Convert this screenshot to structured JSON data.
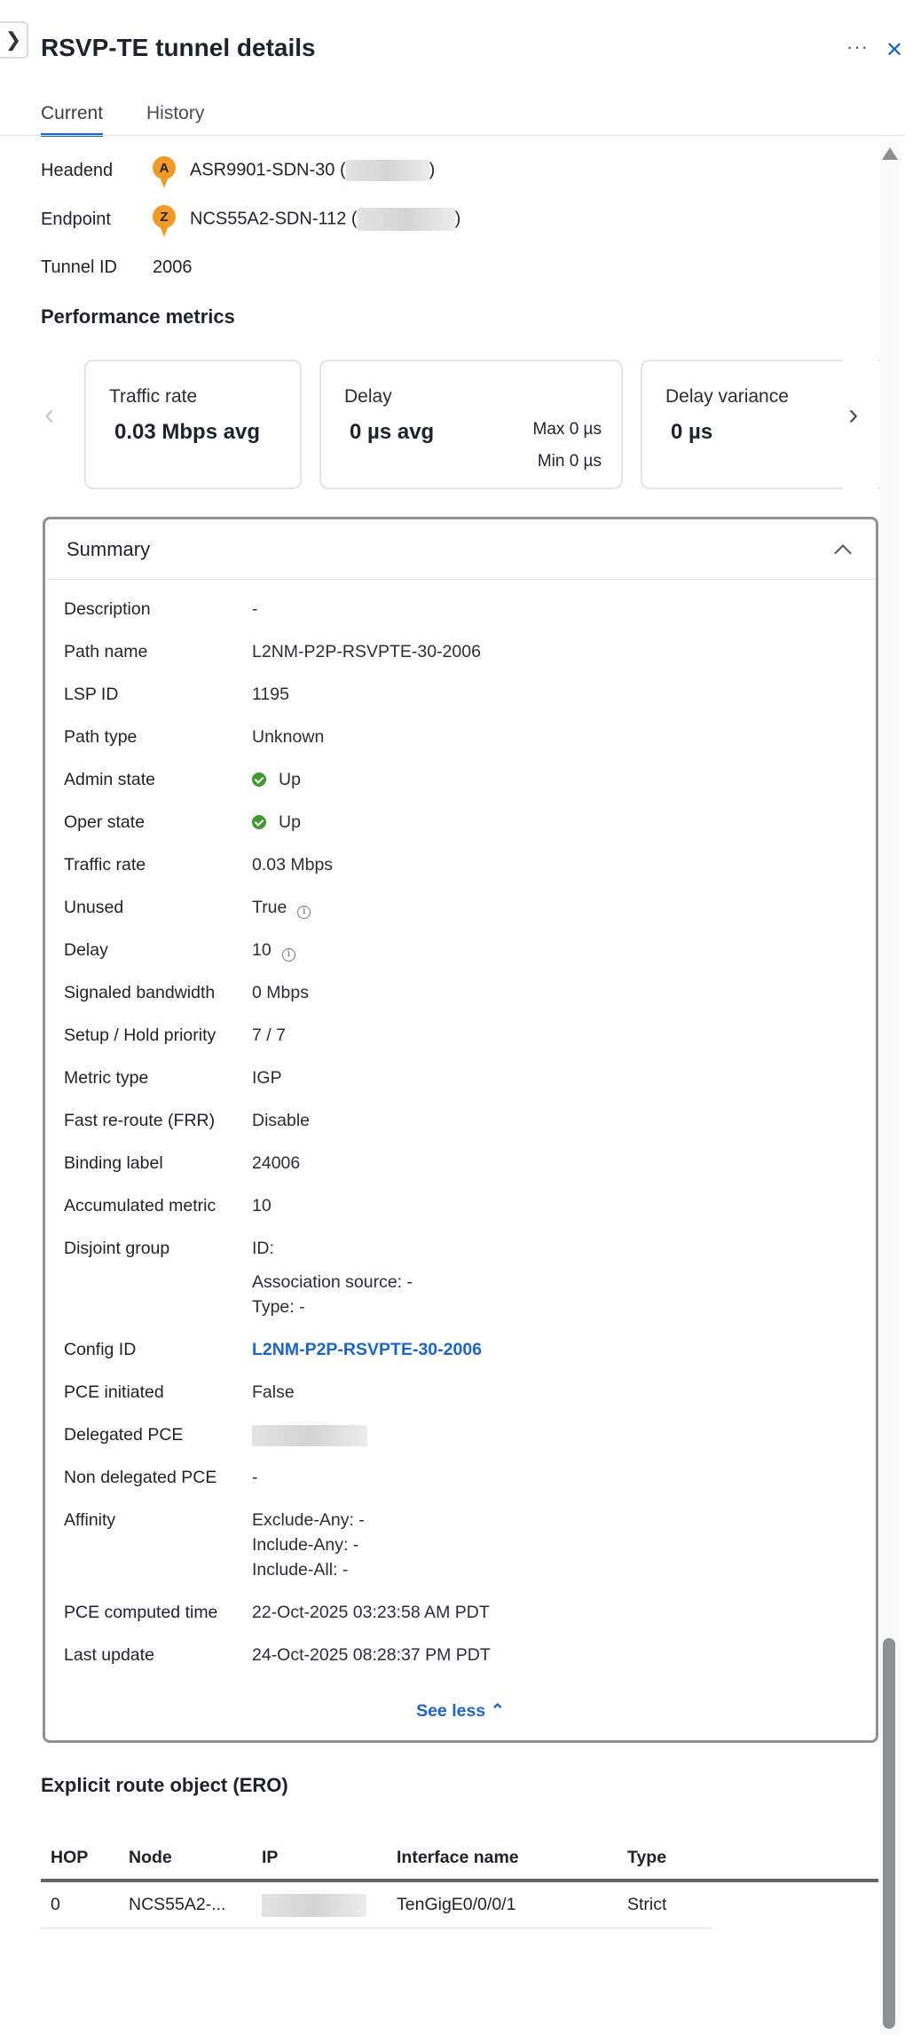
{
  "header": {
    "title": "RSVP-TE tunnel details",
    "more_label": "···",
    "close_label": "✕",
    "collapse_label": "❯"
  },
  "tabs": [
    {
      "label": "Current",
      "active": true
    },
    {
      "label": "History",
      "active": false
    }
  ],
  "info": {
    "headend": {
      "label": "Headend",
      "marker": "A",
      "value": "ASR9901-SDN-30 (",
      "suffix": ")"
    },
    "endpoint": {
      "label": "Endpoint",
      "marker": "Z",
      "value": "NCS55A2-SDN-112 (",
      "suffix": ")"
    },
    "tunnel_id": {
      "label": "Tunnel ID",
      "value": "2006"
    }
  },
  "performance": {
    "title": "Performance metrics",
    "cards": [
      {
        "label": "Traffic rate",
        "value": "0.03 Mbps avg"
      },
      {
        "label": "Delay",
        "value": "0 µs avg",
        "max": "Max 0 µs",
        "min": "Min 0 µs"
      },
      {
        "label": "Delay variance",
        "value": "0 µs"
      }
    ]
  },
  "summary": {
    "title": "Summary",
    "see_less": "See less ⌃",
    "rows": [
      {
        "label": "Description",
        "value": "-"
      },
      {
        "label": "Path name",
        "value": "L2NM-P2P-RSVPTE-30-2006"
      },
      {
        "label": "LSP ID",
        "value": "1195"
      },
      {
        "label": "Path type",
        "value": "Unknown"
      },
      {
        "label": "Admin state",
        "value": "Up"
      },
      {
        "label": "Oper state",
        "value": "Up"
      },
      {
        "label": "Traffic rate",
        "value": "0.03 Mbps"
      },
      {
        "label": "Unused",
        "value": "True"
      },
      {
        "label": "Delay",
        "value": "10"
      },
      {
        "label": "Signaled bandwidth",
        "value": "0 Mbps"
      },
      {
        "label": "Setup / Hold priority",
        "value": "7 / 7"
      },
      {
        "label": "Metric type",
        "value": "IGP"
      },
      {
        "label": "Fast re-route (FRR)",
        "value": "Disable"
      },
      {
        "label": "Binding label",
        "value": "24006"
      },
      {
        "label": "Accumulated metric",
        "value": "10"
      },
      {
        "label": "Disjoint group",
        "value": "ID:",
        "value2": "Association source: -",
        "value3": "Type: -"
      },
      {
        "label": "Config ID",
        "value": "L2NM-P2P-RSVPTE-30-2006"
      },
      {
        "label": "PCE initiated",
        "value": "False"
      },
      {
        "label": "Delegated PCE",
        "value": ""
      },
      {
        "label": "Non delegated PCE",
        "value": "-"
      },
      {
        "label": "Affinity",
        "value": "Exclude-Any: -",
        "value2": "Include-Any: -",
        "value3": "Include-All: -"
      },
      {
        "label": "PCE computed time",
        "value": "22-Oct-2025 03:23:58 AM PDT"
      },
      {
        "label": "Last update",
        "value": "24-Oct-2025 08:28:37 PM PDT"
      }
    ]
  },
  "ero": {
    "title": "Explicit route object (ERO)",
    "columns": [
      "HOP",
      "Node",
      "IP",
      "Interface name",
      "Type"
    ],
    "rows": [
      {
        "hop": "0",
        "node": "NCS55A2-...",
        "interface": "TenGigE0/0/0/1",
        "type": "Strict"
      }
    ]
  },
  "colors": {
    "accent": "#1a66c9",
    "marker": "#f29a25",
    "ok": "#3d9a2f"
  }
}
